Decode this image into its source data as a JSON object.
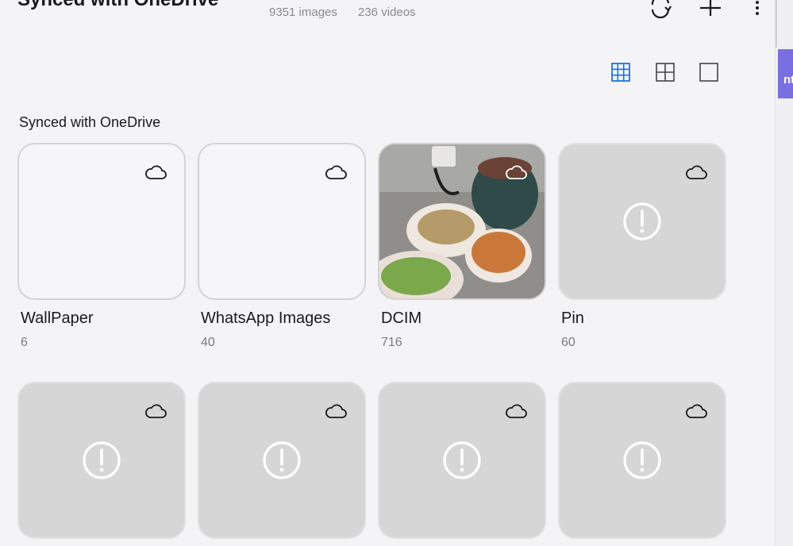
{
  "header": {
    "title": "Synced with OneDrive",
    "image_count": "9351 images",
    "video_count": "236 videos"
  },
  "toolbar": {
    "icons": [
      "sync-icon",
      "add-icon",
      "more-options-icon"
    ]
  },
  "view_options": {
    "icons": [
      "small-grid-icon",
      "medium-grid-icon",
      "large-view-icon"
    ],
    "selected": "small-grid-icon",
    "accent_color": "#1a73e8"
  },
  "section": {
    "title": "Synced with OneDrive"
  },
  "albums": [
    {
      "name": "WallPaper",
      "count": "6",
      "state": "empty"
    },
    {
      "name": "WhatsApp Images",
      "count": "40",
      "state": "empty"
    },
    {
      "name": "DCIM",
      "count": "716",
      "state": "photo"
    },
    {
      "name": "Pin",
      "count": "60",
      "state": "error"
    }
  ],
  "albums_row2": [
    {
      "state": "error"
    },
    {
      "state": "error"
    },
    {
      "state": "error"
    },
    {
      "state": "error"
    }
  ],
  "right_panel": {
    "partial_text": "nt"
  }
}
